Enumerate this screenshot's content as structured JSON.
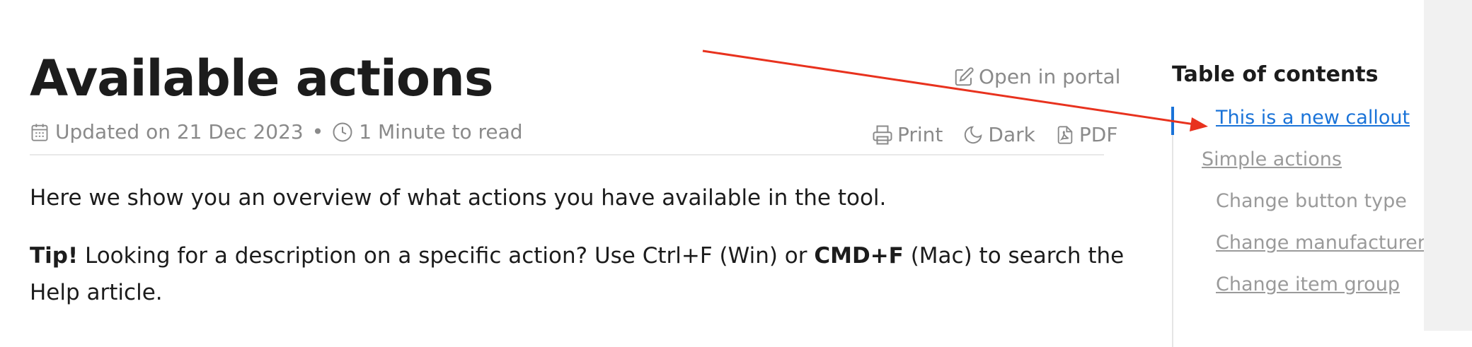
{
  "page": {
    "title": "Available actions",
    "open_portal_label": "Open in portal",
    "meta": {
      "updated": "Updated on 21 Dec 2023",
      "separator": "•",
      "read_time": "1 Minute to read"
    },
    "toolbar": {
      "print_label": "Print",
      "dark_label": "Dark",
      "pdf_label": "PDF"
    },
    "body": {
      "intro": "Here we show you an overview of what actions you have available in the tool.",
      "tip_label": "Tip!",
      "tip_text_1": " Looking for a description on a specific action? Use Ctrl+F (Win) or ",
      "tip_shortcut": "CMD+F",
      "tip_text_2": "  (Mac) to search the Help article."
    }
  },
  "toc": {
    "title": "Table of contents",
    "items": [
      {
        "label": "This is a new callout",
        "active": true
      },
      {
        "label": "Simple actions",
        "active": false
      },
      {
        "label": "Change button type",
        "active": false
      },
      {
        "label": "Change manufacturer",
        "active": false
      },
      {
        "label": "Change item group",
        "active": false
      }
    ]
  },
  "colors": {
    "accent": "#1a73d8",
    "muted": "#8a8a8a",
    "annotation_arrow": "#e8321e",
    "gutter": "#f1f1f1"
  },
  "icons": {
    "open_portal": "edit-icon",
    "updated": "calendar-icon",
    "read_time": "clock-icon",
    "print": "printer-icon",
    "dark": "moon-icon",
    "pdf": "pdf-file-icon"
  }
}
